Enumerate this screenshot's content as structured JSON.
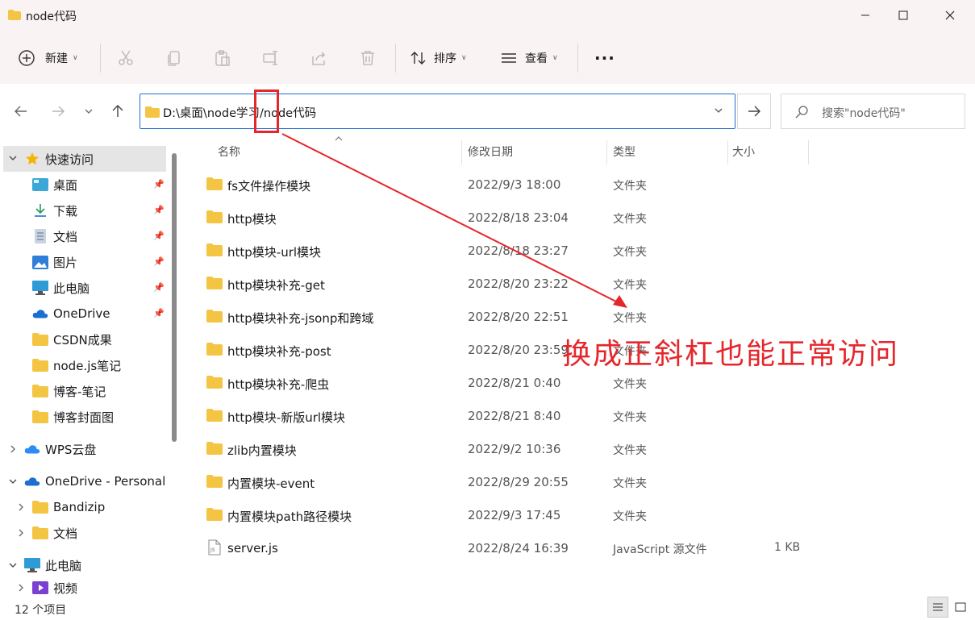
{
  "window": {
    "title": "node代码",
    "minimize_icon": "minimize-icon",
    "maximize_icon": "maximize-icon",
    "close_icon": "close-icon"
  },
  "ribbon": {
    "new_label": "新建",
    "sort_label": "排序",
    "view_label": "查看",
    "more_label": "···",
    "icons": [
      "plus-circle-icon",
      "cut-icon",
      "copy-icon",
      "paste-icon",
      "rename-icon",
      "share-icon",
      "delete-icon",
      "sort-icon",
      "view-icon",
      "more-icon"
    ]
  },
  "navigation": {
    "address_path": "D:\\桌面\\node学习/node代码",
    "search_placeholder": "搜索\"node代码\""
  },
  "sidebar": {
    "quick_access": "快速访问",
    "items": [
      {
        "label": "桌面",
        "icon": "desktop-icon",
        "pinned": true
      },
      {
        "label": "下载",
        "icon": "download-icon",
        "pinned": true
      },
      {
        "label": "文档",
        "icon": "document-icon",
        "pinned": true
      },
      {
        "label": "图片",
        "icon": "pictures-icon",
        "pinned": true
      },
      {
        "label": "此电脑",
        "icon": "computer-icon",
        "pinned": true
      },
      {
        "label": "OneDrive",
        "icon": "onedrive-icon",
        "pinned": true
      },
      {
        "label": "CSDN成果",
        "icon": "folder-icon",
        "pinned": false
      },
      {
        "label": "node.js笔记",
        "icon": "folder-icon",
        "pinned": false
      },
      {
        "label": "博客-笔记",
        "icon": "folder-icon",
        "pinned": false
      },
      {
        "label": "博客封面图",
        "icon": "folder-icon",
        "pinned": false
      }
    ],
    "wps": "WPS云盘",
    "onedrive_personal": "OneDrive - Personal",
    "bandizip": "Bandizip",
    "docs": "文档",
    "this_pc": "此电脑",
    "videos": "视频"
  },
  "columns": {
    "name": "名称",
    "date": "修改日期",
    "type": "类型",
    "size": "大小"
  },
  "files": [
    {
      "name": "fs文件操作模块",
      "date": "2022/9/3 18:00",
      "type": "文件夹",
      "size": ""
    },
    {
      "name": "http模块",
      "date": "2022/8/18 23:04",
      "type": "文件夹",
      "size": ""
    },
    {
      "name": "http模块-url模块",
      "date": "2022/8/18 23:27",
      "type": "文件夹",
      "size": ""
    },
    {
      "name": "http模块补充-get",
      "date": "2022/8/20 23:22",
      "type": "文件夹",
      "size": ""
    },
    {
      "name": "http模块补充-jsonp和跨域",
      "date": "2022/8/20 22:51",
      "type": "文件夹",
      "size": ""
    },
    {
      "name": "http模块补充-post",
      "date": "2022/8/20 23:59",
      "type": "文件夹",
      "size": ""
    },
    {
      "name": "http模块补充-爬虫",
      "date": "2022/8/21 0:40",
      "type": "文件夹",
      "size": ""
    },
    {
      "name": "http模块-新版url模块",
      "date": "2022/8/21 8:40",
      "type": "文件夹",
      "size": ""
    },
    {
      "name": "zlib内置模块",
      "date": "2022/9/2 10:36",
      "type": "文件夹",
      "size": ""
    },
    {
      "name": "内置模块-event",
      "date": "2022/8/29 20:55",
      "type": "文件夹",
      "size": ""
    },
    {
      "name": "内置模块path路径模块",
      "date": "2022/9/3 17:45",
      "type": "文件夹",
      "size": ""
    },
    {
      "name": "server.js",
      "date": "2022/8/24 16:39",
      "type": "JavaScript 源文件",
      "size": "1 KB"
    }
  ],
  "status": {
    "item_count": "12 个项目"
  },
  "annotation": {
    "text": "换成正斜杠也能正常访问",
    "color": "#e5262b"
  },
  "colors": {
    "accent": "#1f6fcf",
    "folder": "#f4c542",
    "titlebar_bg": "#f9f3f3"
  }
}
